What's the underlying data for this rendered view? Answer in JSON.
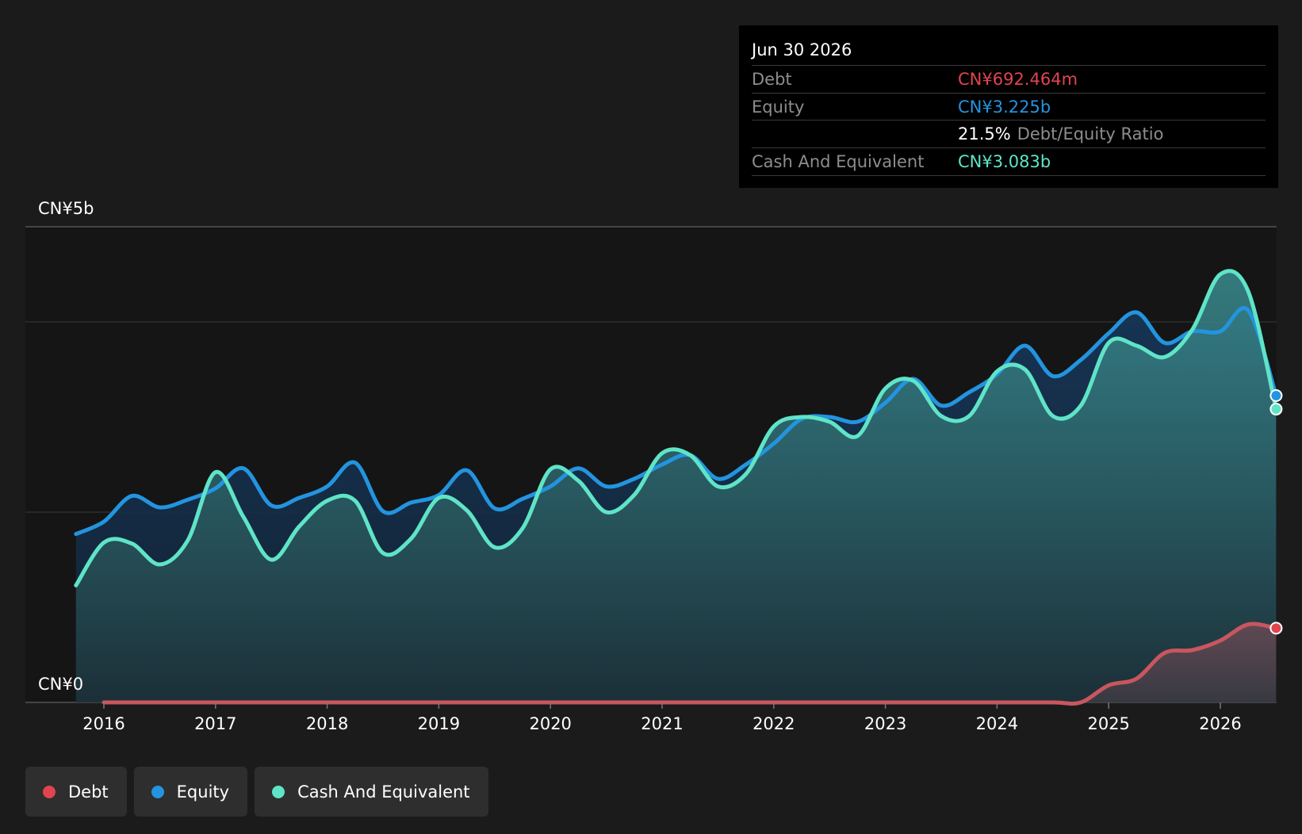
{
  "chart_data": {
    "type": "area",
    "y_axis": {
      "min": 0,
      "max": 5,
      "unit": "CN¥ billions",
      "labels": [
        "CN¥5b",
        "CN¥0"
      ]
    },
    "x_axis": {
      "ticks": [
        "2016",
        "2017",
        "2018",
        "2019",
        "2020",
        "2021",
        "2022",
        "2023",
        "2024",
        "2025",
        "2026"
      ]
    },
    "grid": true,
    "legend_position": "bottom-left",
    "series": [
      {
        "name": "Debt",
        "color": "#e0444f",
        "x": [
          2016.0,
          2016.5,
          2017.0,
          2017.5,
          2018.0,
          2018.5,
          2019.0,
          2019.5,
          2020.0,
          2020.5,
          2021.0,
          2021.5,
          2022.0,
          2022.5,
          2023.0,
          2023.5,
          2024.0,
          2024.5,
          2024.75,
          2025.0,
          2025.25,
          2025.5,
          2025.75,
          2026.0,
          2026.25,
          2026.5
        ],
        "values": [
          0,
          0,
          0,
          0,
          0,
          0,
          0,
          0,
          0,
          0,
          0,
          0,
          0,
          0,
          0,
          0,
          0,
          0,
          0,
          0.18,
          0.25,
          0.52,
          0.55,
          0.65,
          0.82,
          0.78
        ]
      },
      {
        "name": "Equity",
        "color": "#2394df",
        "x": [
          2015.75,
          2016.0,
          2016.25,
          2016.5,
          2016.75,
          2017.0,
          2017.25,
          2017.5,
          2017.75,
          2018.0,
          2018.25,
          2018.5,
          2018.75,
          2019.0,
          2019.25,
          2019.5,
          2019.75,
          2020.0,
          2020.25,
          2020.5,
          2020.75,
          2021.0,
          2021.25,
          2021.5,
          2021.75,
          2022.0,
          2022.25,
          2022.5,
          2022.75,
          2023.0,
          2023.25,
          2023.5,
          2023.75,
          2024.0,
          2024.25,
          2024.5,
          2024.75,
          2025.0,
          2025.25,
          2025.5,
          2025.75,
          2026.0,
          2026.25,
          2026.5
        ],
        "values": [
          1.77,
          1.9,
          2.17,
          2.05,
          2.13,
          2.25,
          2.46,
          2.07,
          2.15,
          2.27,
          2.52,
          2.01,
          2.1,
          2.18,
          2.44,
          2.04,
          2.14,
          2.27,
          2.46,
          2.27,
          2.35,
          2.5,
          2.6,
          2.35,
          2.5,
          2.72,
          2.98,
          3.0,
          2.95,
          3.15,
          3.4,
          3.12,
          3.26,
          3.45,
          3.75,
          3.43,
          3.6,
          3.88,
          4.1,
          3.78,
          3.9,
          3.9,
          4.12,
          3.225
        ]
      },
      {
        "name": "Cash And Equivalent",
        "color": "#5fe4c7",
        "x": [
          2015.75,
          2016.0,
          2016.25,
          2016.5,
          2016.75,
          2017.0,
          2017.25,
          2017.5,
          2017.75,
          2018.0,
          2018.25,
          2018.5,
          2018.75,
          2019.0,
          2019.25,
          2019.5,
          2019.75,
          2020.0,
          2020.25,
          2020.5,
          2020.75,
          2021.0,
          2021.25,
          2021.5,
          2021.75,
          2022.0,
          2022.25,
          2022.5,
          2022.75,
          2023.0,
          2023.25,
          2023.5,
          2023.75,
          2024.0,
          2024.25,
          2024.5,
          2024.75,
          2025.0,
          2025.25,
          2025.5,
          2025.75,
          2026.0,
          2026.25,
          2026.5
        ],
        "values": [
          1.23,
          1.68,
          1.67,
          1.45,
          1.7,
          2.42,
          1.95,
          1.5,
          1.85,
          2.12,
          2.12,
          1.57,
          1.72,
          2.15,
          2.02,
          1.63,
          1.83,
          2.45,
          2.33,
          2.0,
          2.18,
          2.62,
          2.6,
          2.27,
          2.4,
          2.9,
          3.0,
          2.95,
          2.8,
          3.3,
          3.38,
          3.01,
          3.01,
          3.48,
          3.5,
          3.01,
          3.12,
          3.78,
          3.75,
          3.63,
          3.92,
          4.5,
          4.32,
          3.083
        ]
      }
    ]
  },
  "tooltip": {
    "date": "Jun 30 2026",
    "debt_label": "Debt",
    "debt_value": "CN¥692.464m",
    "equity_label": "Equity",
    "equity_value": "CN¥3.225b",
    "ratio_value": "21.5%",
    "ratio_label": "Debt/Equity Ratio",
    "cash_label": "Cash And Equivalent",
    "cash_value": "CN¥3.083b"
  },
  "legend": [
    {
      "label": "Debt",
      "color": "#e0444f"
    },
    {
      "label": "Equity",
      "color": "#2394df"
    },
    {
      "label": "Cash And Equivalent",
      "color": "#5fe4c7"
    }
  ],
  "colors": {
    "background": "#1b1b1b",
    "plot_background": "#151515",
    "debt": "#e0444f",
    "equity": "#2394df",
    "cash": "#5fe4c7"
  }
}
